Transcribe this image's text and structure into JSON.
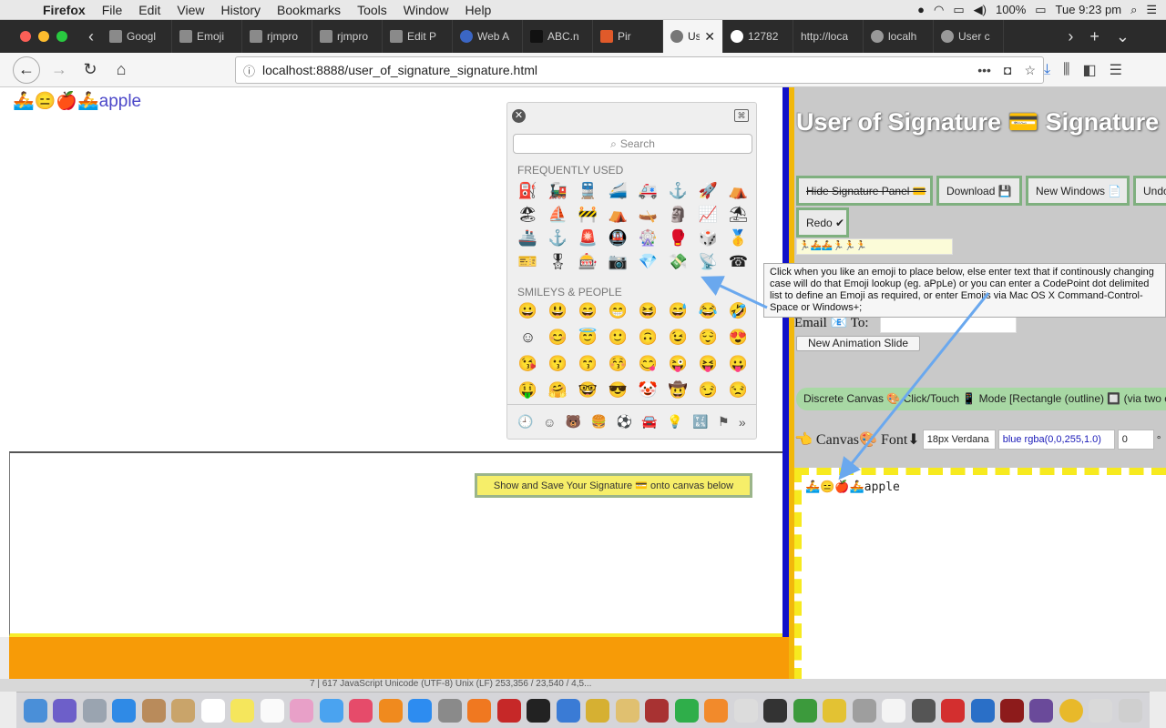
{
  "menubar": {
    "app": "Firefox",
    "items": [
      "File",
      "Edit",
      "View",
      "History",
      "Bookmarks",
      "Tools",
      "Window",
      "Help"
    ],
    "battery": "100%",
    "clock": "Tue 9:23 pm"
  },
  "tabs": [
    {
      "label": "Googl"
    },
    {
      "label": "Emoji"
    },
    {
      "label": "rjmpro"
    },
    {
      "label": "rjmpro"
    },
    {
      "label": "Edit P"
    },
    {
      "label": "Web A"
    },
    {
      "label": "ABC.n"
    },
    {
      "label": "Pir"
    },
    {
      "label": "Us",
      "active": true
    },
    {
      "label": "12782"
    },
    {
      "label": "http://loca"
    },
    {
      "label": "localh"
    },
    {
      "label": "User c"
    }
  ],
  "navbar": {
    "url": "localhost:8888/user_of_signature_signature.html"
  },
  "left": {
    "text": "🚣😑🍎🚣apple",
    "show_save_label": "Show and Save Your Signature 💳 onto canvas below"
  },
  "picker": {
    "search_placeholder": "Search",
    "section_frequent": "FREQUENTLY USED",
    "frequent": [
      "⛽",
      "🚂",
      "🚆",
      "🚄",
      "🚑",
      "⚓",
      "🚀",
      "⛺",
      "🏖",
      "⛵",
      "🚧",
      "⛺",
      "🛶",
      "🗿",
      "📈",
      "⛱",
      "🚢",
      "⚓",
      "🚨",
      "🚇",
      "🎡",
      "🥊",
      "🎲",
      "🥇",
      "🎫",
      "🎖",
      "🎰",
      "📷",
      "💎",
      "💸",
      "📡",
      "☎"
    ],
    "section_smileys": "SMILEYS & PEOPLE",
    "smileys": [
      "😀",
      "😃",
      "😄",
      "😁",
      "😆",
      "😅",
      "😂",
      "🤣",
      "☺",
      "😊",
      "😇",
      "🙂",
      "🙃",
      "😉",
      "😌",
      "😍",
      "😘",
      "😗",
      "😙",
      "😚",
      "😋",
      "😜",
      "😝",
      "😛",
      "🤑",
      "🤗",
      "🤓",
      "😎",
      "🤡",
      "🤠",
      "😏",
      "😒"
    ],
    "categories": [
      "🕘",
      "☺",
      "🐻",
      "🍔",
      "⚽",
      "🚘",
      "💡",
      "🔣",
      "⚑",
      "»"
    ]
  },
  "right": {
    "title": "User of Signature 💳 Signature",
    "hide_label": "Hide Signature Panel 💳",
    "download_label": "Download 💾",
    "new_windows_label": "New Windows 📄",
    "undo_label": "Undo",
    "redo_label": "Redo ✔",
    "emoji_input_value": "🏃🚣🚣🏃🏃🏃",
    "email_label": "Email 📧 To:",
    "new_animation_label": "New Animation Slide",
    "discrete_label": "Discrete Canvas 🎨 Click/Touch 📱 Mode [Rectangle (outline) 🔲 (via two cl",
    "canvas_label": "👈 Canvas🎨 Font⬇",
    "font_value": "18px Verdana",
    "color_value": "blue rgba(0,0,255,1.0)",
    "number_value": "0",
    "degree": "°",
    "canvas_text": "🚣😑🍎🚣apple"
  },
  "tooltip": {
    "text": "Click when you like an emoji to place below, else enter text that if continously changing case will do that Emoji lookup (eg. aPpLe) or you can enter a CodePoint dot delimited list to define an Emoji as required, or enter Emojis via Mac OS X Command-Control-Space or Windows+;"
  },
  "statusbar": {
    "text": "7 | 617   JavaScript   Unicode (UTF-8)   Unix (LF)   253,356 / 23,540 / 4,5..."
  },
  "colors": {
    "divider_blue": "#1212c8",
    "divider_yellow": "#f2b80b",
    "orange_bar": "#f79b07",
    "button_border": "#7fb07f",
    "arrow": "#6aa8ee"
  }
}
